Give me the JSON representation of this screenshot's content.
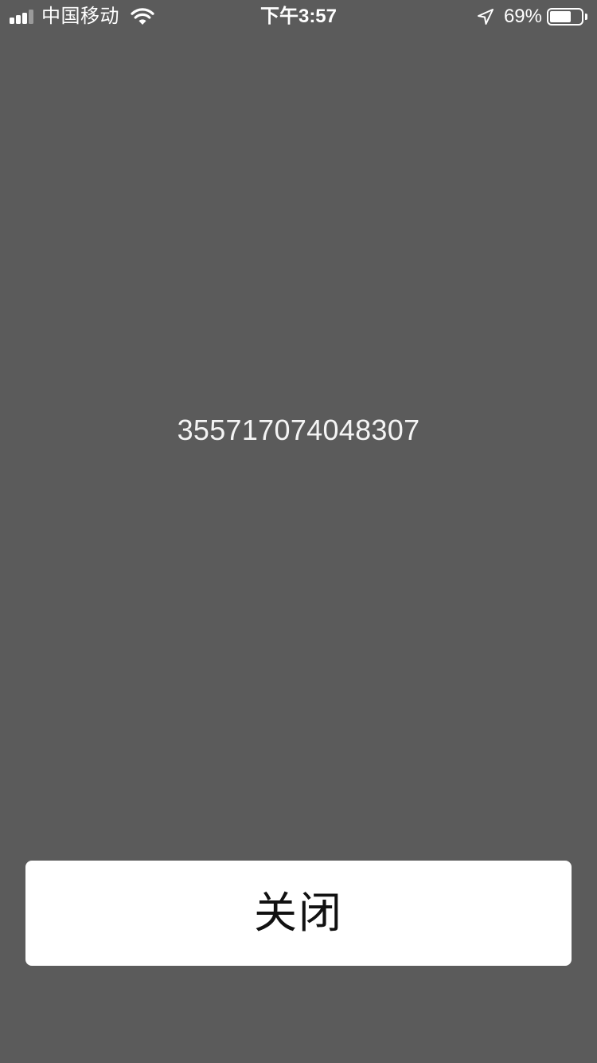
{
  "status_bar": {
    "carrier": "中国移动",
    "time": "下午3:57",
    "battery_percent": "69%",
    "battery_level": 0.69,
    "signal_bars_filled": 3,
    "signal_bars_total": 4,
    "icons": [
      "signal-icon",
      "wifi-icon",
      "location-arrow-icon",
      "battery-icon"
    ]
  },
  "main": {
    "value": "355717074048307"
  },
  "footer": {
    "close_label": "关闭"
  },
  "colors": {
    "background": "#5b5b5b",
    "button": "#ffffff",
    "text_light": "#ffffff",
    "text_dark": "#111111"
  }
}
